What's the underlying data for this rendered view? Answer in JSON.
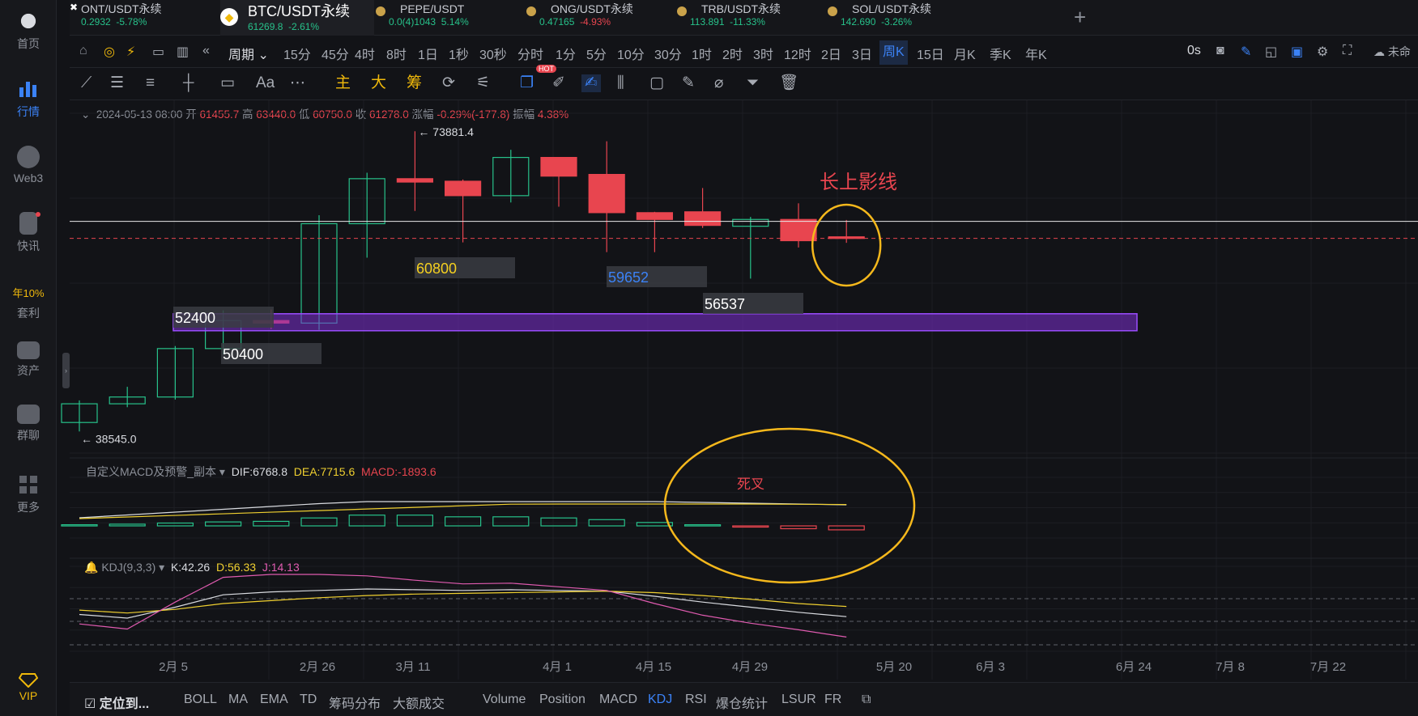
{
  "sidebar": [
    {
      "label": "首页",
      "icon": "home-icon",
      "active": false
    },
    {
      "label": "行情",
      "icon": "market-chart-icon",
      "active": true
    },
    {
      "label": "Web3",
      "icon": "web3-icon",
      "active": false
    },
    {
      "label": "快讯",
      "icon": "news-icon",
      "active": false
    },
    {
      "label": "年10%",
      "sub": "套利",
      "icon": "",
      "active": false
    },
    {
      "label": "资产",
      "icon": "wallet-icon",
      "active": false
    },
    {
      "label": "群聊",
      "icon": "chat-icon",
      "active": false
    },
    {
      "label": "更多",
      "icon": "more-grid-icon",
      "active": false
    },
    {
      "label": "VIP",
      "icon": "vip-diamond-icon",
      "active": false
    }
  ],
  "tabs": [
    {
      "name": "ONT/USDT永续",
      "price": "0.2932",
      "change": "-5.78%"
    },
    {
      "name": "BTC/USDT永续",
      "price": "61269.8",
      "change": "-2.61%",
      "active": true
    },
    {
      "name": "PEPE/USDT",
      "price": "0.0(4)1043",
      "change": "5.14%"
    },
    {
      "name": "ONG/USDT永续",
      "price": "0.47165",
      "change": "-4.93%"
    },
    {
      "name": "TRB/USDT永续",
      "price": "113.891",
      "change": "-11.33%"
    },
    {
      "name": "SOL/USDT永续",
      "price": "142.690",
      "change": "-3.26%"
    }
  ],
  "timeframes": [
    "周期",
    "15分",
    "45分",
    "4时",
    "8时",
    "1日",
    "1秒",
    "30秒",
    "分时",
    "1分",
    "5分",
    "10分",
    "30分",
    "1时",
    "2时",
    "3时",
    "12时",
    "2日",
    "3日",
    "周K",
    "15日",
    "月K",
    "季K",
    "年K"
  ],
  "active_timeframe": "周K",
  "toolbar_right": {
    "countdown": "0s",
    "cloud_label": "未命"
  },
  "draw_tools": {
    "text_tool": "Aa",
    "main": "主",
    "big": "大",
    "chips": "筹",
    "hot": "HOT"
  },
  "ohlc": {
    "date": "2024-05-13 08:00",
    "open_label": "开",
    "open": "61455.7",
    "high_label": "高",
    "high": "63440.0",
    "low_label": "低",
    "low": "60750.0",
    "close_label": "收",
    "close": "61278.0",
    "chg_label": "涨幅",
    "chg": "-0.29%(-177.8)",
    "amp_label": "振幅",
    "amp": "4.38%"
  },
  "price_labels": {
    "high": "← 73881.4",
    "low": "← 38545.0"
  },
  "annotations": {
    "upper_shadow": "长上影线",
    "death_cross": "死叉",
    "levels": [
      "52400",
      "50400",
      "60800",
      "59652",
      "56537"
    ]
  },
  "macd": {
    "title": "自定义MACD及预警_副本",
    "dif": "DIF:6768.8",
    "dea": "DEA:7715.6",
    "macd": "MACD:-1893.6"
  },
  "kdj": {
    "title": "KDJ(9,3,3)",
    "k": "K:42.26",
    "d": "D:56.33",
    "j": "J:14.13"
  },
  "x_axis": [
    "2月 5",
    "2月 26",
    "3月 11",
    "4月 1",
    "4月 15",
    "4月 29",
    "5月 20",
    "6月 3",
    "6月 24",
    "7月 8",
    "7月 22"
  ],
  "bottom": [
    "定位到...",
    "BOLL",
    "MA",
    "EMA",
    "TD",
    "筹码分布",
    "大额成交",
    "Volume",
    "Position",
    "MACD",
    "KDJ",
    "RSI",
    "爆仓统计",
    "LSUR",
    "FR"
  ],
  "bottom_active": "KDJ",
  "colors": {
    "up": "#27c18a",
    "down": "#e8454f",
    "accent": "#3b82f6",
    "zone": "#7b2fd0",
    "circle": "#f5b81c"
  },
  "chart_data": {
    "type": "candlestick",
    "interval": "1W",
    "candles": [
      {
        "date": "2024-01-22",
        "open": 39600,
        "high": 42200,
        "low": 38545,
        "close": 41800
      },
      {
        "date": "2024-01-29",
        "open": 41800,
        "high": 43800,
        "low": 41400,
        "close": 42600
      },
      {
        "date": "2024-02-05",
        "open": 42600,
        "high": 48600,
        "low": 42300,
        "close": 48300
      },
      {
        "date": "2024-02-12",
        "open": 48300,
        "high": 52800,
        "low": 47600,
        "close": 51600
      },
      {
        "date": "2024-02-19",
        "open": 51600,
        "high": 52900,
        "low": 50600,
        "close": 51300
      },
      {
        "date": "2024-02-26",
        "open": 51300,
        "high": 64000,
        "low": 50500,
        "close": 63000
      },
      {
        "date": "2024-03-04",
        "open": 63000,
        "high": 69000,
        "low": 59000,
        "close": 68300
      },
      {
        "date": "2024-03-11",
        "open": 68300,
        "high": 73881.4,
        "low": 64500,
        "close": 67900
      },
      {
        "date": "2024-03-18",
        "open": 68000,
        "high": 68200,
        "low": 60800,
        "close": 66300
      },
      {
        "date": "2024-03-25",
        "open": 66300,
        "high": 71700,
        "low": 65500,
        "close": 70800
      },
      {
        "date": "2024-04-01",
        "open": 70800,
        "high": 70800,
        "low": 65000,
        "close": 68600
      },
      {
        "date": "2024-04-08",
        "open": 68800,
        "high": 72700,
        "low": 59652,
        "close": 64300
      },
      {
        "date": "2024-04-15",
        "open": 64300,
        "high": 64400,
        "low": 59652,
        "close": 63500
      },
      {
        "date": "2024-04-22",
        "open": 64400,
        "high": 67200,
        "low": 62500,
        "close": 62800
      },
      {
        "date": "2024-04-29",
        "open": 62700,
        "high": 63800,
        "low": 56537,
        "close": 63500
      },
      {
        "date": "2024-05-06",
        "open": 63500,
        "high": 65400,
        "low": 60200,
        "close": 61000
      },
      {
        "date": "2024-05-13",
        "open": 61455.7,
        "high": 63440,
        "low": 60750,
        "close": 61278
      }
    ],
    "macd_hist": [
      0.2,
      0.3,
      0.5,
      0.7,
      0.8,
      1.4,
      1.9,
      1.9,
      1.6,
      1.6,
      1.4,
      1.1,
      0.6,
      0.2,
      -0.1,
      -0.5,
      -0.7
    ],
    "ylim": [
      36000,
      76000
    ]
  }
}
